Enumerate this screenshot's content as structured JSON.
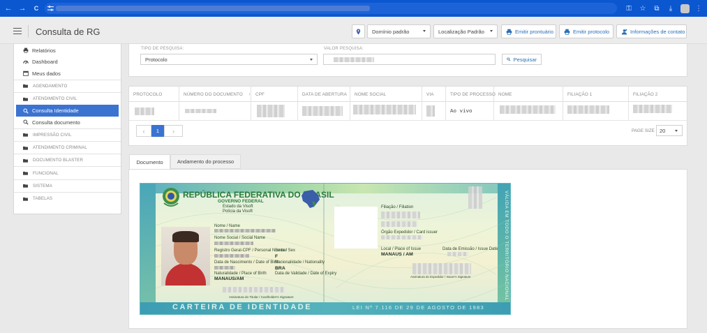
{
  "browser": {
    "nav_back": "←",
    "nav_forward": "→",
    "nav_reload": "C"
  },
  "app": {
    "title": "Consulta de RG",
    "domain_select": "Domínio padrão",
    "location_select": "Localização Padrão",
    "btn_prontuario": "Emitir prontuário",
    "btn_protocolo": "Emitir protocolo",
    "btn_contato": "Informações de contato"
  },
  "sidebar": {
    "items": [
      {
        "label": "Relatórios",
        "icon": "printer-icon"
      },
      {
        "label": "Dashboard",
        "icon": "gauge-icon"
      },
      {
        "label": "Meus dados",
        "icon": "calendar-icon"
      }
    ],
    "groups": [
      {
        "label": "AGENDAMENTO"
      },
      {
        "label": "ATENDIMENTO CIVIL"
      }
    ],
    "sub_items": [
      {
        "label": "Consulta Identidade",
        "active": true
      },
      {
        "label": "Consulta documento",
        "active": false
      }
    ],
    "groups2": [
      {
        "label": "IMPRESSÃO CIVIL"
      },
      {
        "label": "ATENDIMENTO CRIMINAL"
      },
      {
        "label": "DOCUMENTO BLASTER"
      },
      {
        "label": "FUNCIONAL"
      },
      {
        "label": "SISTEMA"
      },
      {
        "label": "TABELAS"
      }
    ]
  },
  "search": {
    "type_label": "TIPO DE PESQUISA:",
    "type_value": "Protocolo",
    "value_label": "VALOR PESQUISA:",
    "button": "Pesquisar"
  },
  "table": {
    "columns": [
      "PROTOCOLO",
      "NÚMERO DO DOCUMENTO",
      "CPF",
      "DATA DE ABERTURA",
      "NOME SOCIAL",
      "VIA",
      "TIPO DE PROCESSO",
      "NOME",
      "FILIAÇÃO 1",
      "FILIAÇÃO 2"
    ],
    "sort_indicator": "↑",
    "row_process_type": "Ao vivo",
    "current_page": "1",
    "prev": "‹",
    "next": "›",
    "page_size_label": "PAGE SIZE",
    "page_size": "20"
  },
  "tabs": [
    {
      "label": "Documento",
      "active": true
    },
    {
      "label": "Andamento do processo",
      "active": false
    }
  ],
  "card": {
    "title": "REPÚBLICA FEDERATIVA DO BRASIL",
    "subtitle": "GOVERNO FEDERAL",
    "line3": "Estado da Visoft",
    "line4": "Polícia da Visoft",
    "name_label": "Nome / Name",
    "social_label": "Nome Social / Social Name",
    "reg_label": "Registro Geral-CPF / Personal Number",
    "sex_label": "Sexo / Sex",
    "sex_value": "F",
    "birth_label": "Data de Nascimento / Date of Birth",
    "nationality_label": "Nacionalidade / Nationality",
    "nationality_value": "BRA",
    "birthplace_label": "Naturalidade / Place of Birth",
    "birthplace_value": "MANAUS/AM",
    "expiry_label": "Data de Validade / Date of Expiry",
    "signature_label": "Assinatura do Titular / Cardholder's Signature",
    "parents_label": "Filiação / Filiation",
    "issuer_label": "Órgão Expedidor / Card issuer",
    "issue_place_label": "Local / Place of Issue",
    "issue_place_value": "MANAUS / AM",
    "issue_date_label": "Data de Emissão / Issue Date",
    "issuer_sig_label": "Assinatura do Expedidor / Issuer's Signature",
    "bottom_title": "CARTEIRA DE IDENTIDADE",
    "bottom_law": "LEI Nº 7.116 DE 29 DE AGOSTO DE 1983",
    "side_text": "VÁLIDA EM TODO O TERRITÓRIO NACIONAL"
  }
}
